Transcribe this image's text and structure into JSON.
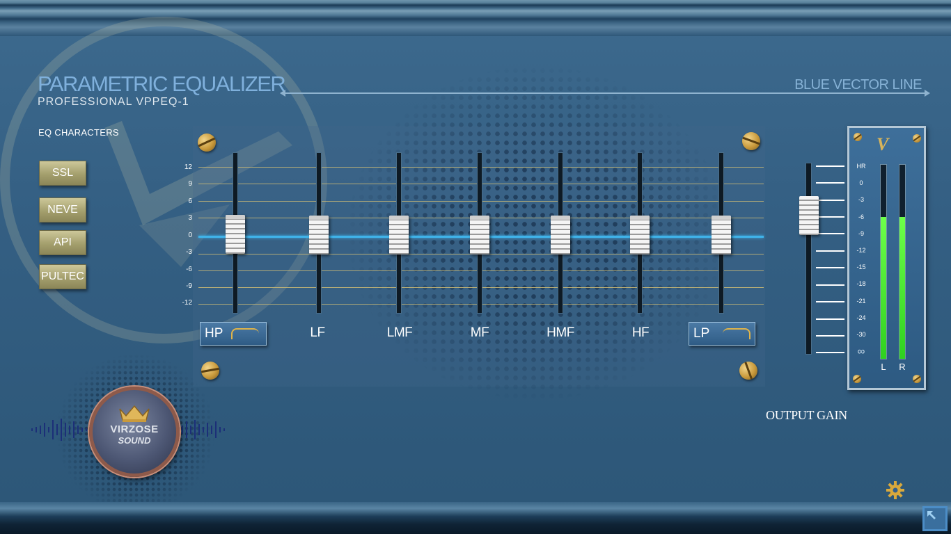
{
  "header": {
    "title": "PARAMETRIC EQUALIZER",
    "subtitle": "PROFESSIONAL  VPPEQ-1",
    "brand": "BLUE VECTOR LINE"
  },
  "eq_characters": {
    "label": "EQ  CHARACTERS",
    "buttons": [
      "SSL",
      "NEVE",
      "API",
      "PULTEC"
    ]
  },
  "eq_scale": [
    "12",
    "9",
    "6",
    "3",
    "0",
    "-3",
    "-6",
    "-9",
    "-12"
  ],
  "bands": [
    {
      "label": "HP",
      "type": "filter",
      "gain": 0
    },
    {
      "label": "LF",
      "type": "band",
      "gain": 0
    },
    {
      "label": "LMF",
      "type": "band",
      "gain": 0
    },
    {
      "label": "MF",
      "type": "band",
      "gain": 0
    },
    {
      "label": "HMF",
      "type": "band",
      "gain": 0
    },
    {
      "label": "HF",
      "type": "band",
      "gain": 0
    },
    {
      "label": "LP",
      "type": "filter",
      "gain": 0
    }
  ],
  "output": {
    "label": "OUTPUT GAIN",
    "meter_logo": "V",
    "meter_scale": [
      "HR",
      "0",
      "-3",
      "-6",
      "-9",
      "-12",
      "-15",
      "-18",
      "-21",
      "-24",
      "-30",
      "∞"
    ],
    "channels": [
      "L",
      "R"
    ],
    "level_L": "-6",
    "level_R": "-6"
  },
  "logo": {
    "line1": "VIRZOSE",
    "line2": "SOUND"
  },
  "icons": {
    "settings": "gear-icon",
    "resize": "resize-icon"
  },
  "colors": {
    "accent": "#3fb3ea",
    "meter": "#4cf03a",
    "button_gold": "#a49f6d"
  }
}
